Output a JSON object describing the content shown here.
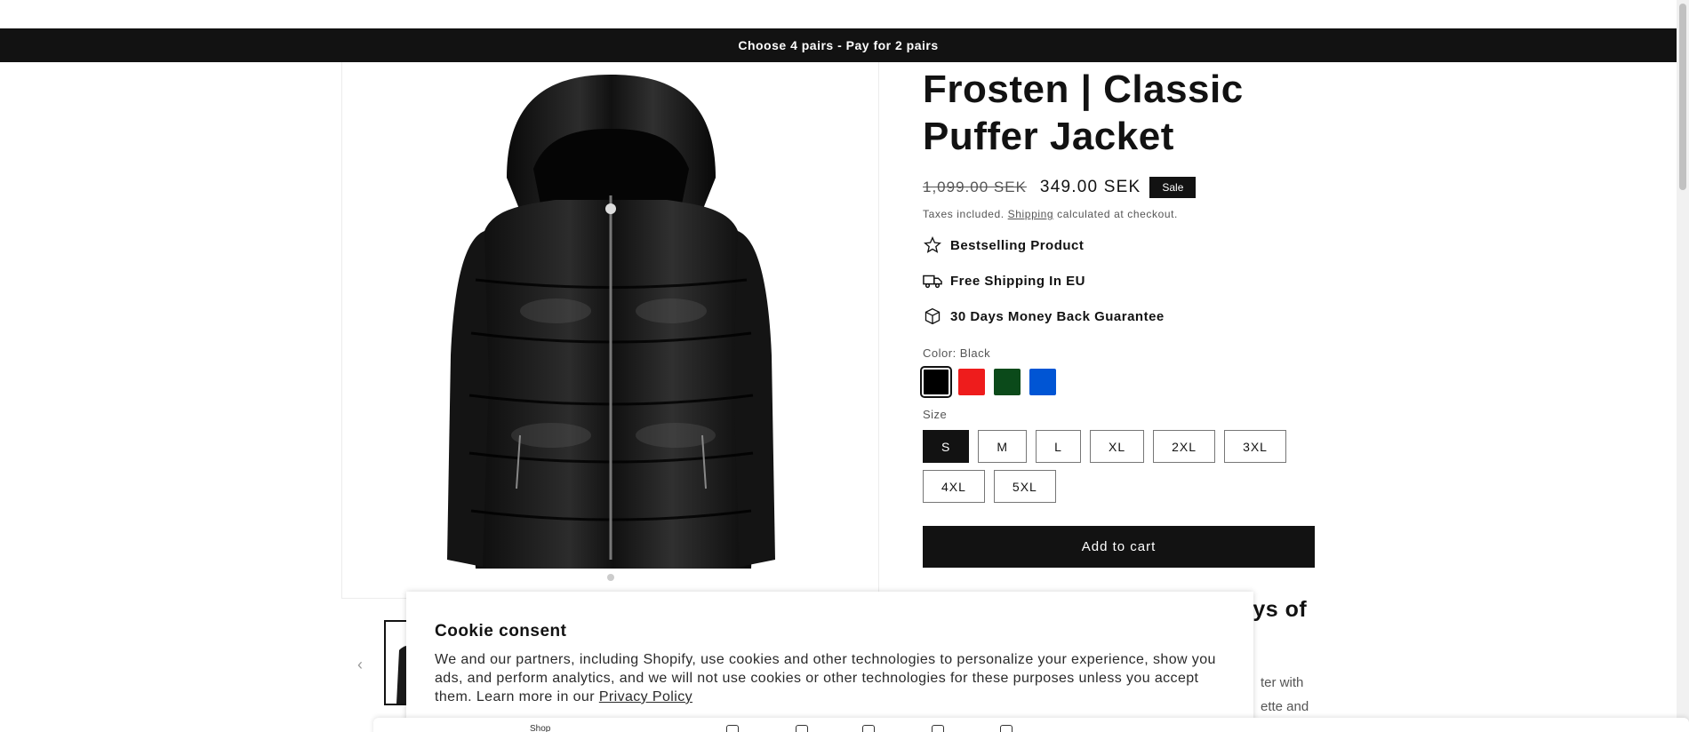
{
  "announcement": {
    "text": "Choose 4 pairs - Pay for 2 pairs"
  },
  "product": {
    "title": "Frosten | Classic Puffer Jacket",
    "price_old": "1,099.00 SEK",
    "price_new": "349.00 SEK",
    "badge": "Sale",
    "tax_prefix": "Taxes included.",
    "tax_link": "Shipping",
    "tax_suffix": "calculated at checkout.",
    "image_icon": "black-puffer-jacket-image"
  },
  "features": [
    {
      "icon": "star-icon",
      "label": "Bestselling Product"
    },
    {
      "icon": "truck-icon",
      "label": "Free Shipping In EU"
    },
    {
      "icon": "box-icon",
      "label": "30 Days Money Back Guarantee"
    }
  ],
  "color": {
    "label": "Color: Black",
    "swatches": [
      {
        "name": "Black",
        "hex": "#000000",
        "selected": true
      },
      {
        "name": "Red",
        "hex": "#ee1c1c",
        "selected": false
      },
      {
        "name": "Green",
        "hex": "#0b4a1a",
        "selected": false
      },
      {
        "name": "Blue",
        "hex": "#0055d4",
        "selected": false
      }
    ]
  },
  "size": {
    "label": "Size",
    "options": [
      "S",
      "M",
      "L",
      "XL",
      "2XL",
      "3XL",
      "4XL",
      "5XL"
    ],
    "selected": "S"
  },
  "cart": {
    "label": "Add to cart"
  },
  "behind_text": {
    "heading_fragment": "ays of",
    "line1_fragment": "ter with",
    "line2_fragment": "ette and"
  },
  "cookie": {
    "title": "Cookie consent",
    "body": "We and our partners, including Shopify, use cookies and other technologies to personalize your experience, show you ads, and perform analytics, and we will not use cookies or other technologies for these purposes unless you accept them. Learn more in our",
    "link": "Privacy Policy"
  },
  "bottom_bar": {
    "shop_label": "Shop"
  },
  "colors": {
    "dark": "#121212",
    "muted": "#555555"
  }
}
